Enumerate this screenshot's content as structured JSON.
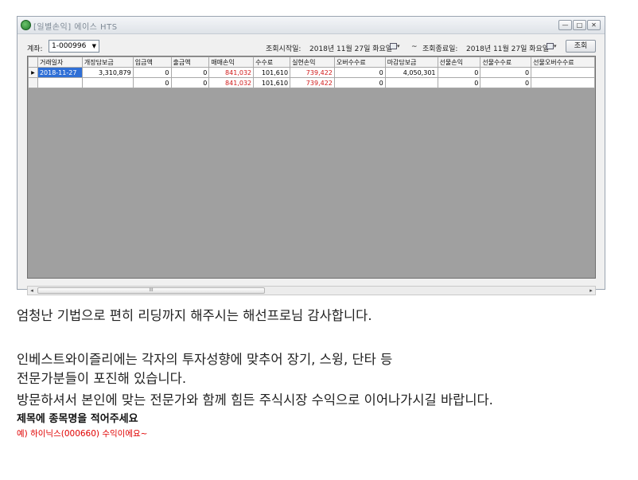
{
  "window": {
    "title": "[일별손익] 에이스 HTS",
    "controls": {
      "minimize": "—",
      "maximize": "□",
      "close": "✕"
    }
  },
  "toolbar": {
    "account_label": "계좌:",
    "account_value": "1-000996",
    "start_label": "조회시작일:",
    "start_date": "2018년 11월 27일 화요일",
    "tilde": "~",
    "end_label": "조회종료일:",
    "end_date": "2018년 11월 27일 화요일",
    "query_button": "조회"
  },
  "grid": {
    "columns": [
      "거래일자",
      "개장담보금",
      "입금액",
      "출금액",
      "매매손익",
      "수수료",
      "실현손익",
      "오버수수료",
      "마감담보금",
      "선물손익",
      "선물수수료",
      "선물오버수수료"
    ],
    "rows": [
      [
        "2018-11-27",
        "3,310,879",
        "0",
        "0",
        "841,032",
        "101,610",
        "739,422",
        "0",
        "4,050,301",
        "0",
        "0",
        ""
      ],
      [
        "",
        "",
        "0",
        "0",
        "841,032",
        "101,610",
        "739,422",
        "0",
        "",
        "0",
        "0",
        ""
      ]
    ],
    "row_marker": "▶",
    "scroll_grip": "III"
  },
  "post": {
    "line1": "엄청난 기법으로 편히 리딩까지 해주시는 해선프로님 감사합니다.",
    "line2": "인베스트와이즐리에는 각자의 투자성향에 맞추어 장기, 스윙, 단타 등",
    "line3": "전문가분들이 포진해 있습니다.",
    "line4": "방문하셔서 본인에 맞는 전문가와 함께 힘든 주식시장 수익으로 이어나가시길 바랍니다.",
    "title_prompt": "제목에 종목명을 적어주세요",
    "example": "예) 하이닉스(000660) 수익이에요~"
  },
  "colors": {
    "selection": "#2f6fd6",
    "profit_red": "#d11919",
    "grid_empty": "#a0a0a0",
    "example_red": "#e00000"
  }
}
